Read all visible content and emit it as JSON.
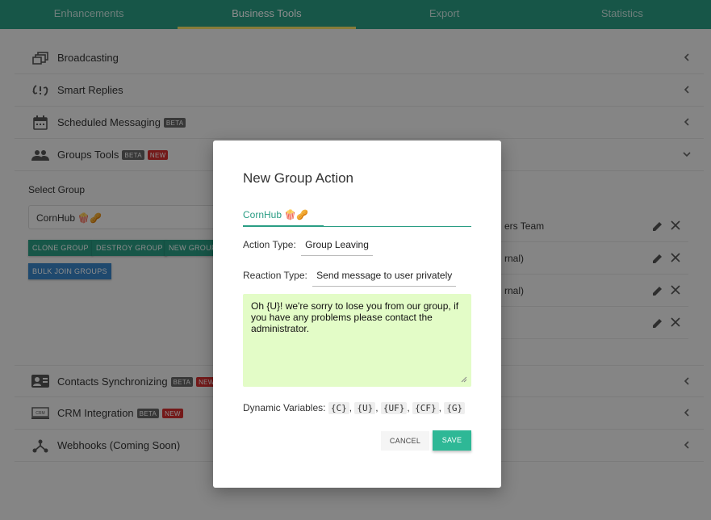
{
  "tabs": [
    "Enhancements",
    "Business Tools",
    "Export",
    "Statistics"
  ],
  "active_tab": "Business Tools",
  "sections": {
    "broadcasting": "Broadcasting",
    "smart_replies": "Smart Replies",
    "scheduled": "Scheduled Messaging",
    "groups_tools": "Groups Tools",
    "contacts_sync": "Contacts Synchronizing",
    "crm": "CRM Integration",
    "webhooks": "Webhooks (Coming Soon)"
  },
  "badges": {
    "beta": "BETA",
    "new": "NEW"
  },
  "groups": {
    "select_label": "Select Group",
    "selected_group": "CornHub 🍿🥜",
    "buttons": {
      "clone": "CLONE GROUP",
      "destroy": "DESTROY GROUP",
      "new": "NEW GROUP",
      "bulk_join": "BULK JOIN GROUPS"
    },
    "members": [
      "ers Team",
      "rnal)",
      "rnal)",
      ""
    ]
  },
  "modal": {
    "title": "New Group Action",
    "tab": "CornHub 🍿🥜",
    "action_type_label": "Action Type:",
    "action_type_value": "Group Leaving",
    "reaction_type_label": "Reaction Type:",
    "reaction_type_value": "Send message to user privately",
    "message": "Oh {U}! we're sorry to lose you from our group, if you have any problems please contact the administrator.",
    "dynamic_label": "Dynamic Variables:",
    "variables": [
      "{C}",
      "{U}",
      "{UF}",
      "{CF}",
      "{G}"
    ],
    "cancel": "CANCEL",
    "save": "SAVE"
  },
  "colors": {
    "header": "#2a9d84",
    "tab_indicator": "#f6e26b",
    "textarea_bg": "#e3fcc7",
    "save": "#2eb896"
  }
}
